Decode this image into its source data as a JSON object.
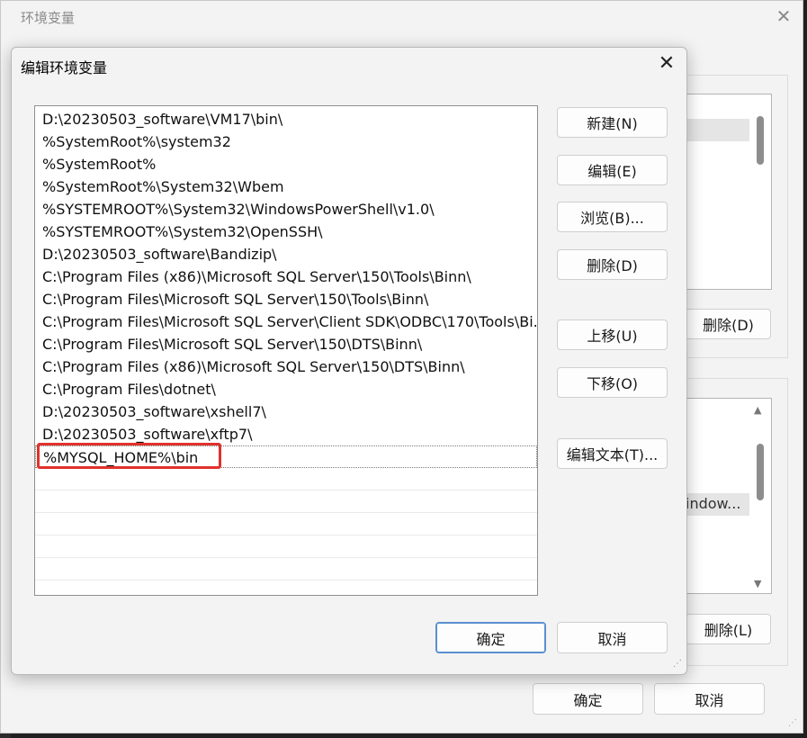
{
  "outer_window": {
    "title": "环境变量",
    "close_glyph": "✕",
    "delete_button_1": "删除(D)",
    "delete_button_2": "删除(L)",
    "ok_button": "确定",
    "cancel_button": "取消",
    "visible_list_fragment": "indow..."
  },
  "dialog": {
    "title": "编辑环境变量",
    "close_glyph": "✕",
    "paths": [
      "D:\\20230503_software\\VM17\\bin\\",
      "%SystemRoot%\\system32",
      "%SystemRoot%",
      "%SystemRoot%\\System32\\Wbem",
      "%SYSTEMROOT%\\System32\\WindowsPowerShell\\v1.0\\",
      "%SYSTEMROOT%\\System32\\OpenSSH\\",
      "D:\\20230503_software\\Bandizip\\",
      "C:\\Program Files (x86)\\Microsoft SQL Server\\150\\Tools\\Binn\\",
      "C:\\Program Files\\Microsoft SQL Server\\150\\Tools\\Binn\\",
      "C:\\Program Files\\Microsoft SQL Server\\Client SDK\\ODBC\\170\\Tools\\Bi...",
      "C:\\Program Files\\Microsoft SQL Server\\150\\DTS\\Binn\\",
      "C:\\Program Files (x86)\\Microsoft SQL Server\\150\\DTS\\Binn\\",
      "C:\\Program Files\\dotnet\\",
      "D:\\20230503_software\\xshell7\\",
      "D:\\20230503_software\\xftp7\\",
      "%MYSQL_HOME%\\bin"
    ],
    "selected_index": 15,
    "buttons": {
      "new": "新建(N)",
      "edit": "编辑(E)",
      "browse": "浏览(B)...",
      "delete": "删除(D)",
      "move_up": "上移(U)",
      "move_down": "下移(O)",
      "edit_text": "编辑文本(T)...",
      "ok": "确定",
      "cancel": "取消"
    },
    "highlight_color": "#e0322b"
  }
}
